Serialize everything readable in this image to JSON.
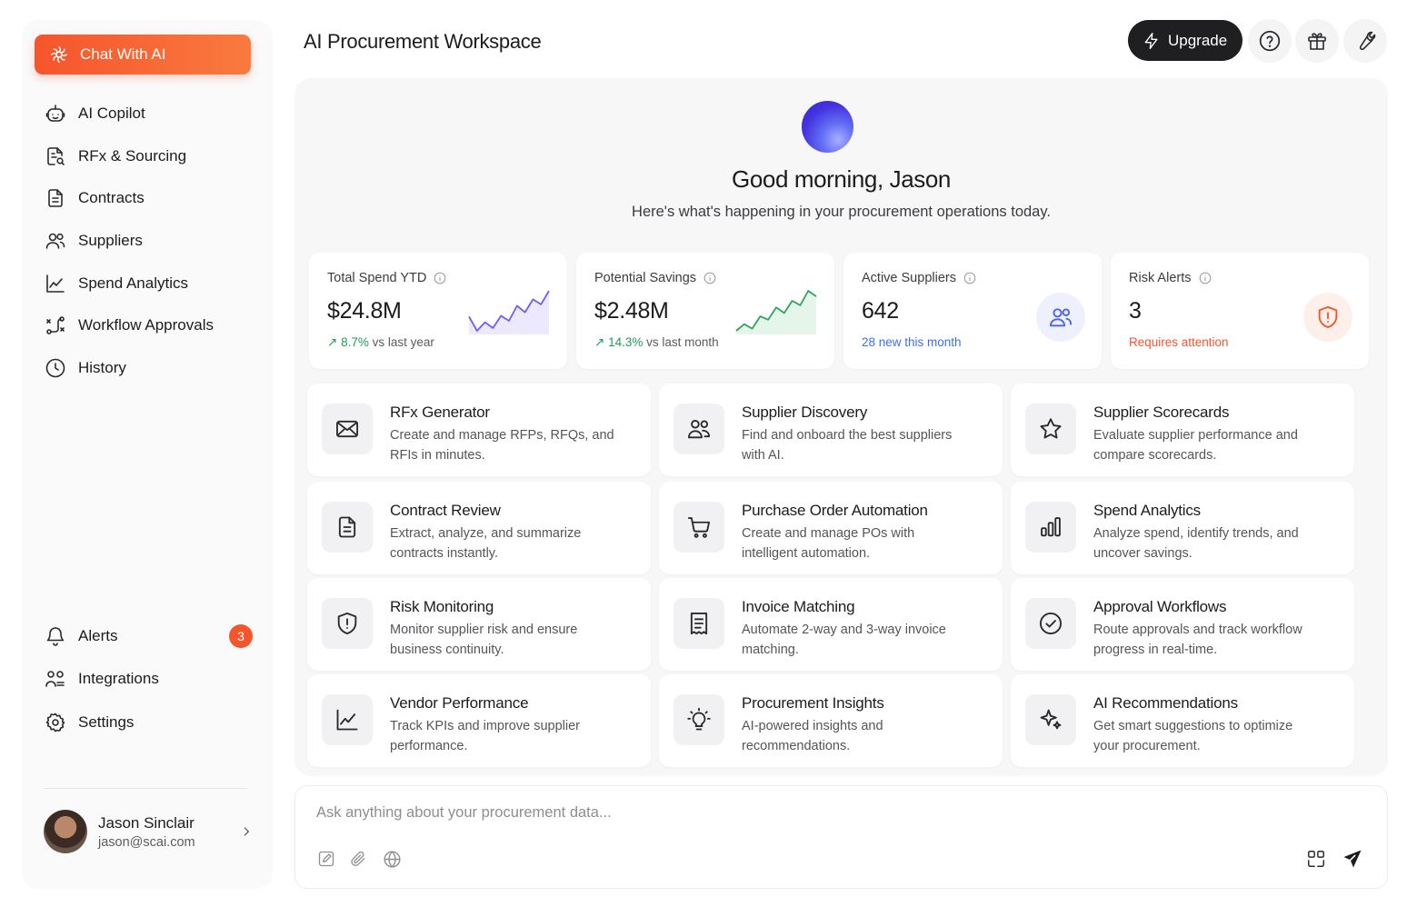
{
  "sidebar": {
    "chat_button": "Chat With AI",
    "nav": [
      {
        "label": "AI Copilot",
        "icon": "robot-icon"
      },
      {
        "label": "RFx & Sourcing",
        "icon": "document-search-icon"
      },
      {
        "label": "Contracts",
        "icon": "document-icon"
      },
      {
        "label": "Suppliers",
        "icon": "users-icon"
      },
      {
        "label": "Spend Analytics",
        "icon": "line-chart-icon"
      },
      {
        "label": "Workflow Approvals",
        "icon": "workflow-icon"
      },
      {
        "label": "History",
        "icon": "clock-icon"
      }
    ],
    "bottom_nav": [
      {
        "label": "Alerts",
        "icon": "bell-icon",
        "badge": "3"
      },
      {
        "label": "Integrations",
        "icon": "integrations-icon"
      },
      {
        "label": "Settings",
        "icon": "gear-icon"
      }
    ],
    "user": {
      "name": "Jason Sinclair",
      "email": "jason@scai.com"
    }
  },
  "header": {
    "title": "AI Procurement Workspace",
    "upgrade_label": "Upgrade"
  },
  "main": {
    "greeting": "Good morning, Jason",
    "subtitle": "Here's what's happening in your procurement operations today.",
    "stats": [
      {
        "label": "Total Spend YTD",
        "value": "$24.8M",
        "change": "8.7%",
        "change_suffix": " vs last year",
        "trend": [
          3,
          1,
          2.2,
          1.4,
          3.1,
          2.4,
          4.5,
          3.6,
          5.4,
          4.7,
          6.6
        ]
      },
      {
        "label": "Potential Savings",
        "value": "$2.48M",
        "change": "14.3%",
        "change_suffix": " vs last month",
        "trend": [
          1,
          1.6,
          1.2,
          2.3,
          2.0,
          3.1,
          2.6,
          3.7,
          3.3,
          4.6,
          4.1
        ]
      },
      {
        "label": "Active Suppliers",
        "value": "642",
        "note": "28 new this month"
      },
      {
        "label": "Risk Alerts",
        "value": "3",
        "note": "Requires attention"
      }
    ],
    "features": [
      {
        "title": "RFx Generator",
        "desc": "Create and manage RFPs, RFQs, and RFIs in minutes."
      },
      {
        "title": "Supplier Discovery",
        "desc": "Find and onboard the best suppliers with AI."
      },
      {
        "title": "Supplier Scorecards",
        "desc": "Evaluate supplier performance and compare scorecards."
      },
      {
        "title": "Contract Review",
        "desc": "Extract, analyze, and summarize contracts instantly."
      },
      {
        "title": "Purchase Order Automation",
        "desc": "Create and manage POs with intelligent automation."
      },
      {
        "title": "Spend Analytics",
        "desc": "Analyze spend, identify trends, and uncover savings."
      },
      {
        "title": "Risk Monitoring",
        "desc": "Monitor supplier risk and ensure business continuity."
      },
      {
        "title": "Invoice Matching",
        "desc": "Automate 2-way and 3-way invoice matching."
      },
      {
        "title": "Approval Workflows",
        "desc": "Route approvals and track workflow progress in real-time."
      },
      {
        "title": "Vendor Performance",
        "desc": "Track KPIs and improve supplier performance."
      },
      {
        "title": "Procurement Insights",
        "desc": "AI-powered insights and recommendations."
      },
      {
        "title": "AI Recommendations",
        "desc": "Get smart suggestions to optimize your procurement."
      }
    ]
  },
  "composer": {
    "placeholder": "Ask anything about your procurement data...",
    "value": ""
  },
  "colors": {
    "accent": "#f6552c",
    "positive": "#1f9d55",
    "link_blue": "#3b6ff2",
    "dark_button": "#1f1f22"
  }
}
